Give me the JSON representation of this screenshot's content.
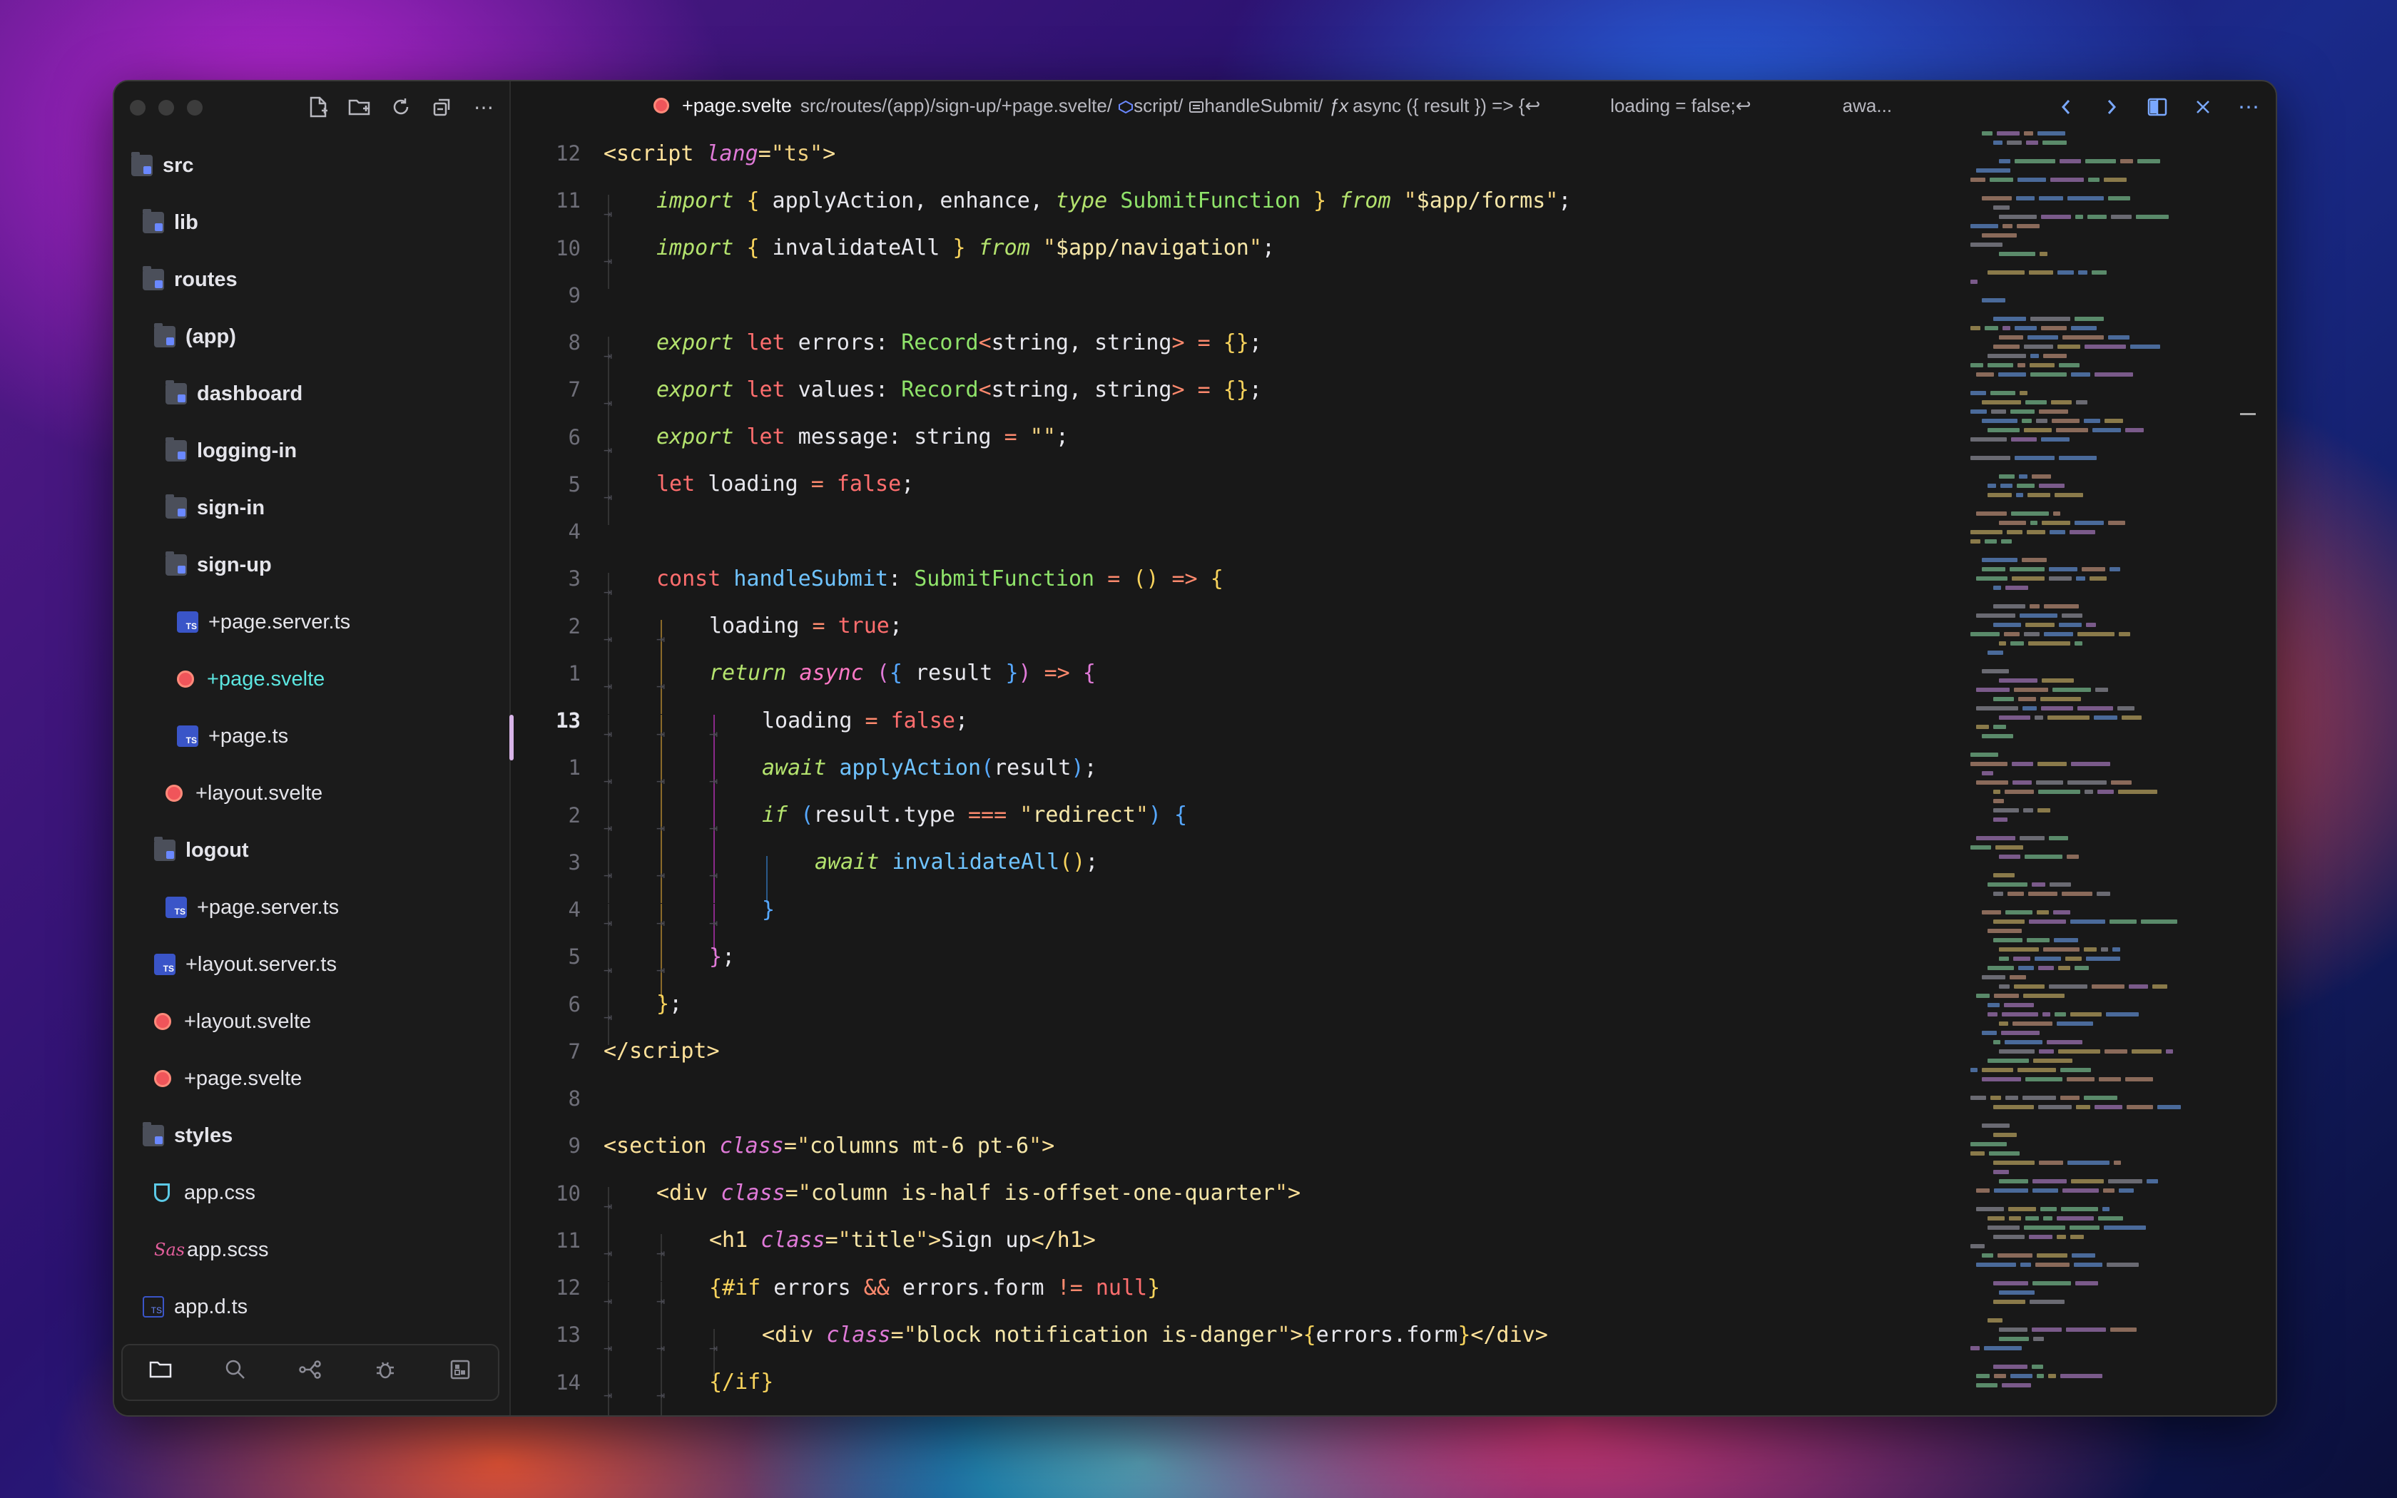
{
  "breadcrumb": {
    "filename": "+page.svelte",
    "path": "src/routes/(app)/sign-up/+page.svelte/",
    "script": "script/",
    "handler": "handleSubmit/",
    "fx": "ƒx",
    "async_sig": "async ({ result }) => {↩",
    "loading": "loading = false;↩",
    "awa": "awa..."
  },
  "sidebar": {
    "tree": [
      {
        "label": "src",
        "kind": "folder",
        "depth": 0,
        "bold": true
      },
      {
        "label": "lib",
        "kind": "folder",
        "depth": 1,
        "bold": true
      },
      {
        "label": "routes",
        "kind": "folder",
        "depth": 1,
        "bold": true
      },
      {
        "label": "(app)",
        "kind": "folder",
        "depth": 2,
        "bold": true
      },
      {
        "label": "dashboard",
        "kind": "folder",
        "depth": 3,
        "bold": true
      },
      {
        "label": "logging-in",
        "kind": "folder",
        "depth": 3,
        "bold": true
      },
      {
        "label": "sign-in",
        "kind": "folder",
        "depth": 3,
        "bold": true
      },
      {
        "label": "sign-up",
        "kind": "folder",
        "depth": 3,
        "bold": true
      },
      {
        "label": "+page.server.ts",
        "kind": "ts",
        "depth": 4
      },
      {
        "label": "+page.svelte",
        "kind": "svelte",
        "depth": 4,
        "active": true
      },
      {
        "label": "+page.ts",
        "kind": "ts",
        "depth": 4
      },
      {
        "label": "+layout.svelte",
        "kind": "svelte",
        "depth": 3
      },
      {
        "label": "logout",
        "kind": "folder",
        "depth": 2,
        "bold": true
      },
      {
        "label": "+page.server.ts",
        "kind": "ts",
        "depth": 3
      },
      {
        "label": "+layout.server.ts",
        "kind": "ts",
        "depth": 2
      },
      {
        "label": "+layout.svelte",
        "kind": "svelte",
        "depth": 2
      },
      {
        "label": "+page.svelte",
        "kind": "svelte",
        "depth": 2
      },
      {
        "label": "styles",
        "kind": "folder",
        "depth": 1,
        "bold": true
      },
      {
        "label": "app.css",
        "kind": "css",
        "depth": 2
      },
      {
        "label": "app.scss",
        "kind": "scss",
        "depth": 2
      },
      {
        "label": "app.d.ts",
        "kind": "dts",
        "depth": 1
      }
    ],
    "bottom_icons": [
      "folder-icon",
      "search-icon",
      "source-control-icon",
      "debug-icon",
      "extensions-icon"
    ]
  },
  "editor": {
    "current_line": "13",
    "line_numbers": [
      "12",
      "11",
      "10",
      "9",
      "8",
      "7",
      "6",
      "5",
      "4",
      "3",
      "2",
      "1",
      "13",
      "1",
      "2",
      "3",
      "4",
      "5",
      "6",
      "7",
      "8",
      "9",
      "10",
      "11",
      "12",
      "13",
      "14"
    ]
  },
  "colors": {
    "accent": "#5ce6e0",
    "keyword": "#ff79c6",
    "function": "#6fc3ff",
    "type": "#8fe36a",
    "string": "#f5e6a8"
  }
}
